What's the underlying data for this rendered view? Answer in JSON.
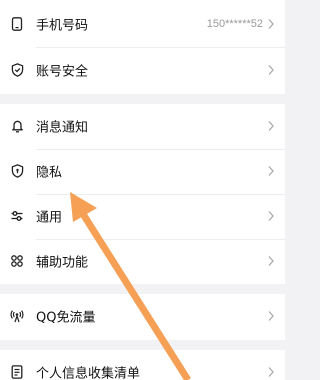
{
  "groups": [
    {
      "items": [
        {
          "label": "手机号码",
          "value": "150******52",
          "icon": "phone-icon"
        },
        {
          "label": "账号安全",
          "icon": "shield-check-icon"
        }
      ]
    },
    {
      "items": [
        {
          "label": "消息通知",
          "icon": "bell-icon"
        },
        {
          "label": "隐私",
          "icon": "privacy-shield-icon"
        },
        {
          "label": "通用",
          "icon": "sliders-icon"
        },
        {
          "label": "辅助功能",
          "icon": "grid-icon"
        }
      ]
    },
    {
      "items": [
        {
          "label": "QQ免流量",
          "icon": "signal-tower-icon"
        }
      ]
    },
    {
      "items": [
        {
          "label": "个人信息收集清单",
          "icon": "document-icon"
        }
      ]
    }
  ],
  "colors": {
    "background": "#f2f2f5",
    "card": "#ffffff",
    "annotation_arrow": "#f5a055",
    "muted_text": "#999999"
  }
}
